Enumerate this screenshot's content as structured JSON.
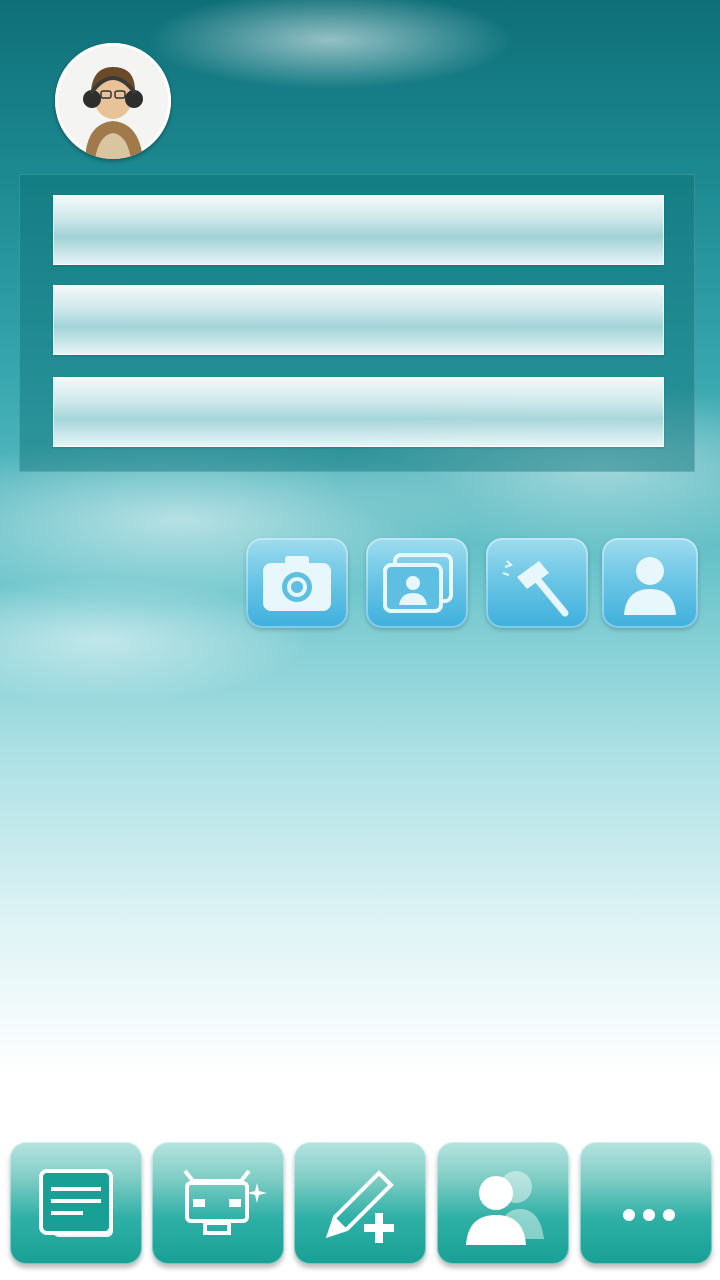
{
  "profile": {
    "avatar_icon": "user-photo-avatar"
  },
  "form": {
    "fields": [
      {
        "name": "field-1",
        "value": "",
        "placeholder": ""
      },
      {
        "name": "field-2",
        "value": "",
        "placeholder": ""
      },
      {
        "name": "field-3",
        "value": "",
        "placeholder": ""
      }
    ]
  },
  "actions": [
    {
      "icon": "camera-icon"
    },
    {
      "icon": "photo-album-icon"
    },
    {
      "icon": "hammer-icon"
    },
    {
      "icon": "person-icon"
    }
  ],
  "tabbar": {
    "tabs": [
      {
        "icon": "messages-icon"
      },
      {
        "icon": "robot-icon"
      },
      {
        "icon": "compose-icon"
      },
      {
        "icon": "contacts-icon"
      },
      {
        "icon": "more-icon"
      }
    ]
  },
  "colors": {
    "accent": "#18a095",
    "action_button": "#3fb0dd",
    "panel": "#0a6e76"
  }
}
